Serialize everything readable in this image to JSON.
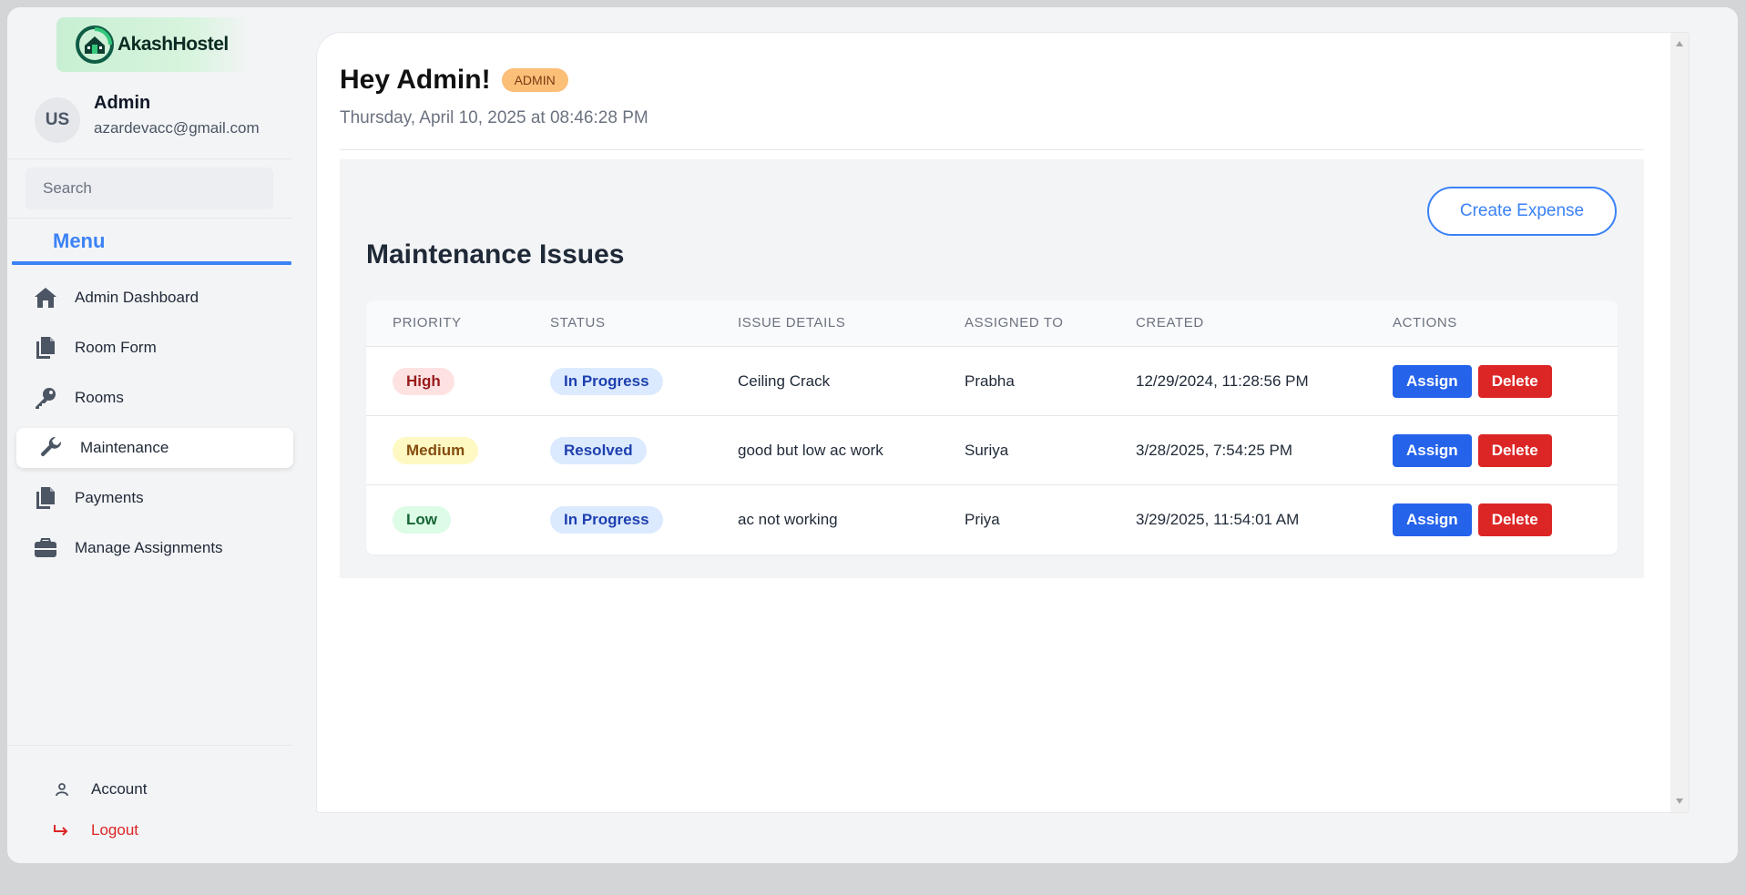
{
  "brand": {
    "name": "AkashHostel"
  },
  "user": {
    "initials": "US",
    "name": "Admin",
    "email": "azardevacc@gmail.com"
  },
  "search": {
    "placeholder": "Search"
  },
  "menu": {
    "title": "Menu",
    "items": [
      {
        "label": "Admin Dashboard",
        "icon": "home-icon",
        "active": false
      },
      {
        "label": "Room Form",
        "icon": "documents-icon",
        "active": false
      },
      {
        "label": "Rooms",
        "icon": "key-icon",
        "active": false
      },
      {
        "label": "Maintenance",
        "icon": "wrench-icon",
        "active": true
      },
      {
        "label": "Payments",
        "icon": "documents-icon",
        "active": false
      },
      {
        "label": "Manage Assignments",
        "icon": "briefcase-icon",
        "active": false
      }
    ]
  },
  "footer": {
    "account_label": "Account",
    "logout_label": "Logout"
  },
  "header": {
    "greeting": "Hey Admin!",
    "role_badge": "ADMIN",
    "datetime": "Thursday, April 10, 2025 at 08:46:28 PM"
  },
  "main": {
    "create_button": "Create Expense",
    "section_title": "Maintenance Issues",
    "columns": [
      "PRIORITY",
      "STATUS",
      "ISSUE DETAILS",
      "ASSIGNED TO",
      "CREATED",
      "ACTIONS"
    ],
    "rows": [
      {
        "priority": "High",
        "status": "In Progress",
        "issue": "Ceiling Crack",
        "assigned_to": "Prabha",
        "created": "12/29/2024, 11:28:56 PM",
        "assign_label": "Assign",
        "delete_label": "Delete"
      },
      {
        "priority": "Medium",
        "status": "Resolved",
        "issue": "good but low ac work",
        "assigned_to": "Suriya",
        "created": "3/28/2025, 7:54:25 PM",
        "assign_label": "Assign",
        "delete_label": "Delete"
      },
      {
        "priority": "Low",
        "status": "In Progress",
        "issue": "ac not working",
        "assigned_to": "Priya",
        "created": "3/29/2025, 11:54:01 AM",
        "assign_label": "Assign",
        "delete_label": "Delete"
      }
    ]
  },
  "colors": {
    "accent": "#3b82f6",
    "assign_button": "#2563eb",
    "delete_button": "#dc2626",
    "role_badge": "#fbbf77",
    "priority_high_bg": "#fee2e2",
    "priority_high_text": "#991b1b",
    "priority_medium_bg": "#fef9c3",
    "priority_medium_text": "#854d0e",
    "priority_low_bg": "#dcfce7",
    "priority_low_text": "#166534",
    "status_bg": "#dbeafe",
    "status_text": "#1e40af",
    "logout": "#dc2626"
  }
}
